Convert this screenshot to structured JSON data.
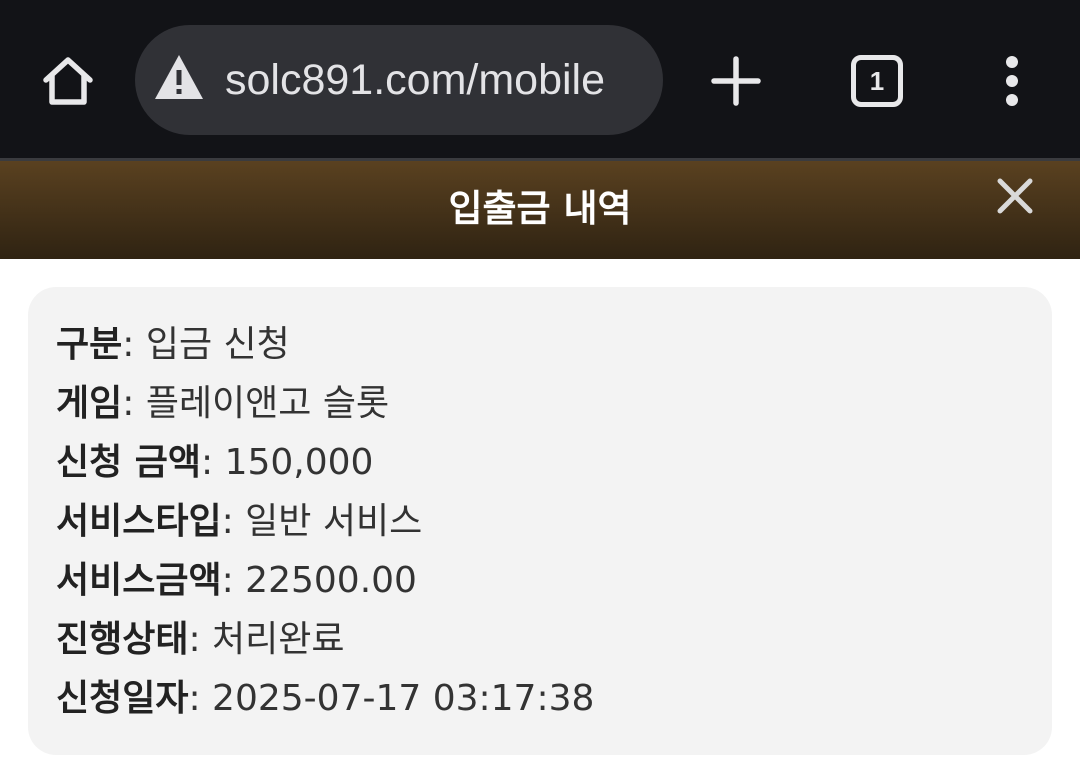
{
  "browser": {
    "url": "solc891.com/mobile",
    "tab_count": "1",
    "icons": {
      "home": "home-icon",
      "security": "warning-triangle-icon",
      "new_tab": "plus-icon",
      "tabs": "tab-switcher-icon",
      "menu": "more-vertical-icon"
    }
  },
  "modal": {
    "title": "입출금 내역",
    "close_icon": "close-icon",
    "colors": {
      "header_top": "#5a4120",
      "header_bottom": "#2f2312",
      "card_bg": "#f3f3f3"
    }
  },
  "details": [
    {
      "label": "구분",
      "value": ": 입금 신청"
    },
    {
      "label": "게임",
      "value": ": 플레이앤고 슬롯"
    },
    {
      "label": "신청 금액",
      "value": ": 150,000"
    },
    {
      "label": "서비스타입",
      "value": ": 일반 서비스"
    },
    {
      "label": "서비스금액",
      "value": ": 22500.00"
    },
    {
      "label": "진행상태",
      "value": ": 처리완료"
    },
    {
      "label": "신청일자",
      "value": ": 2025-07-17 03:17:38"
    }
  ]
}
